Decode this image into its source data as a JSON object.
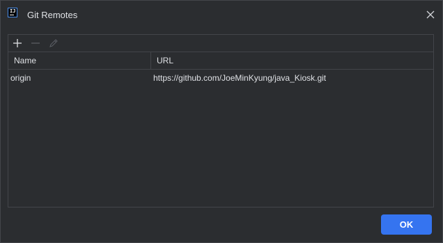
{
  "window": {
    "title": "Git Remotes",
    "app_icon_text": "IJ"
  },
  "toolbar": {
    "add_icon": "plus-icon",
    "remove_icon": "minus-icon",
    "edit_icon": "pencil-icon"
  },
  "table": {
    "columns": [
      "Name",
      "URL"
    ],
    "rows": [
      {
        "name": "origin",
        "url": "https://github.com/JoeMinKyung/java_Kiosk.git"
      }
    ]
  },
  "footer": {
    "ok_label": "OK"
  },
  "colors": {
    "background": "#2b2d30",
    "border": "#43454a",
    "text": "#dfe1e5",
    "accent": "#3574f0"
  }
}
